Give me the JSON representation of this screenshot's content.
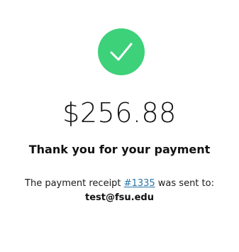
{
  "confirmation": {
    "icon": "check-icon",
    "accent_color": "#3dd17a",
    "amount": "$256.88",
    "heading": "Thank you for your payment",
    "receipt_prefix": "The payment receipt ",
    "receipt_link": "#1335",
    "receipt_suffix": " was sent to:",
    "email": "test@fsu.edu"
  }
}
